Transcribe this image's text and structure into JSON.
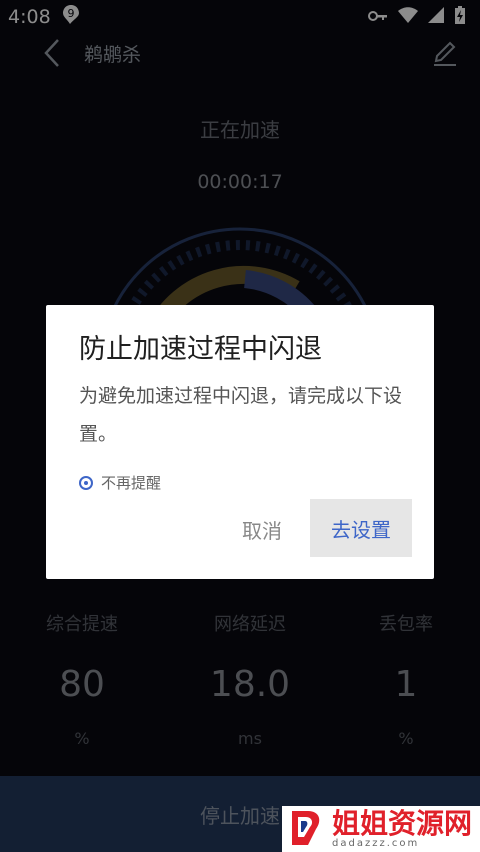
{
  "status_bar": {
    "time": "4:08"
  },
  "app_bar": {
    "title": "鹈鹕杀"
  },
  "main": {
    "status_text": "正在加速",
    "timer": "00:00:17",
    "stats": [
      {
        "label": "综合提速",
        "value": "80",
        "unit": "%"
      },
      {
        "label": "网络延迟",
        "value": "18.0",
        "unit": "ms"
      },
      {
        "label": "丢包率",
        "value": "1",
        "unit": "%"
      }
    ],
    "stop_button": "停止加速"
  },
  "dialog": {
    "title": "防止加速过程中闪退",
    "message": "为避免加速过程中闪退，请完成以下设置。",
    "checkbox_label": "不再提醒",
    "cancel": "取消",
    "confirm": "去设置"
  },
  "watermark": {
    "text": "姐姐资源网",
    "sub": "dadazzz.com"
  },
  "colors": {
    "accent": "#3e66c8",
    "stop_bg": "#233a5e",
    "watermark_red": "#e0202a"
  }
}
